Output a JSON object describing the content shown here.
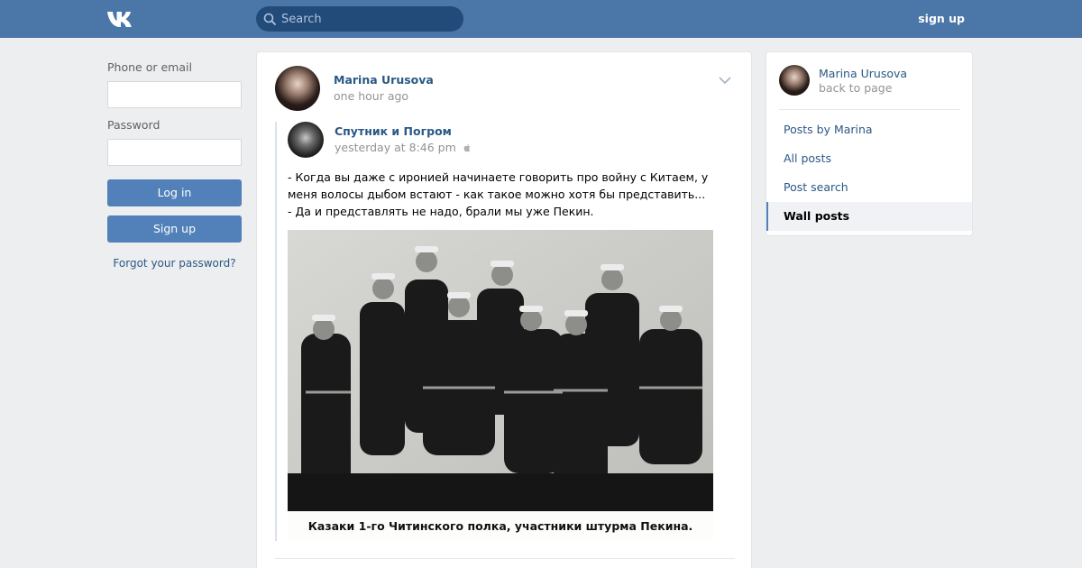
{
  "header": {
    "search_placeholder": "Search",
    "signup_label": "sign up",
    "accent_color": "#4a76a8"
  },
  "login": {
    "phone_label": "Phone or email",
    "password_label": "Password",
    "login_button": "Log in",
    "signup_button": "Sign up",
    "forgot_link": "Forgot your password?"
  },
  "post": {
    "author": "Marina Urusova",
    "time": "one hour ago",
    "repost": {
      "author": "Спутник и Погром",
      "time": "yesterday at 8:46 pm",
      "text": "- Когда вы даже с иронией начинаете говорить про войну с Китаем, у меня волосы дыбом встают - как такое можно хотя бы представить...\n- Да и представлять не надо, брали мы уже Пекин.",
      "photo_caption": "Казаки 1-го Читинского полка, участники штурма Пекина."
    }
  },
  "sidebar": {
    "name": "Marina Urusova",
    "back": "back to page",
    "menu": [
      {
        "label": "Posts by Marina"
      },
      {
        "label": "All posts"
      },
      {
        "label": "Post search"
      },
      {
        "label": "Wall posts"
      }
    ]
  }
}
